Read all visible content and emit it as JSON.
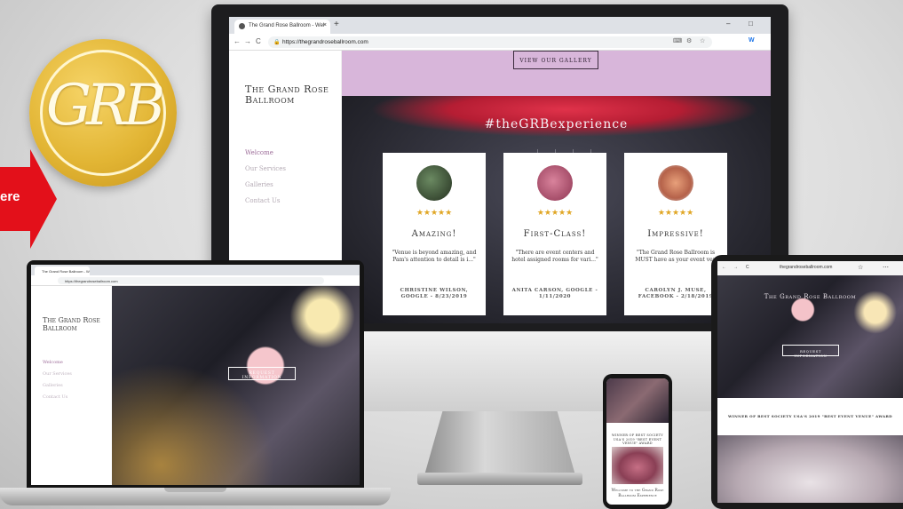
{
  "promo": {
    "arrow_text": "ere",
    "logo_monogram": "GRB",
    "colors": {
      "logo_gold": "#e2b534",
      "arrow_red": "#e3101a"
    }
  },
  "monitor": {
    "browser": {
      "tab_title": "The Grand Rose Ballroom - Wel",
      "tab_close": "×",
      "new_tab": "+",
      "url": "https://thegrandroseballroom.com",
      "back": "←",
      "forward": "→",
      "reload": "C",
      "lock": "🔒",
      "minimize": "–",
      "maximize": "□"
    },
    "site": {
      "brand": "The Grand Rose Ballroom",
      "nav": [
        "Welcome",
        "Our Services",
        "Galleries",
        "Contact Us"
      ],
      "active_nav": "Welcome",
      "gallery_button": "VIEW OUR GALLERY",
      "hashtag": "#theGRBexperience",
      "reviews": [
        {
          "stars": "★★★★★",
          "heading": "Amazing!",
          "quote": "\"Venue is beyond amazing, and Pam's attention to detail is i...\"",
          "author": "CHRISTINE WILSON, GOOGLE - 8/23/2019"
        },
        {
          "stars": "★★★★★",
          "heading": "First-Class!",
          "quote": "\"There are event centers and hotel assigned rooms for vari...\"",
          "author": "ANITA CARSON, GOOGLE - 1/11/2020"
        },
        {
          "stars": "★★★★★",
          "heading": "Impressive!",
          "quote": "\"The Grand Rose Ballroom is MUST have as your event ven",
          "author": "CAROLYN J. MUSE, FACEBOOK - 2/18/2019"
        }
      ],
      "colors": {
        "lilac": "#d8b6da",
        "nav_active": "#9e6e9a",
        "star": "#e0a624"
      }
    }
  },
  "laptop": {
    "tab_title": "The Grand Rose Ballroom - Wel",
    "url": "https://thegrandroseballroom.com",
    "brand": "The Grand Rose Ballroom",
    "nav": [
      "Welcome",
      "Our Services",
      "Galleries",
      "Contact Us"
    ],
    "button": "REQUEST INFORMATION"
  },
  "phone": {
    "award": "WINNER OF BEST SOCIETY USA'S 2019 \"BEST EVENT VENUE\" AWARD",
    "welcome": "Welcome to the Grand Rose Ballroom Experience"
  },
  "tablet": {
    "url": "thegrandroseballroom.com",
    "brand": "The Grand Rose Ballroom",
    "button": "REQUEST INFORMATION",
    "award": "WINNER OF BEST SOCIETY USA'S 2019 \"BEST EVENT VENUE\" AWARD"
  }
}
